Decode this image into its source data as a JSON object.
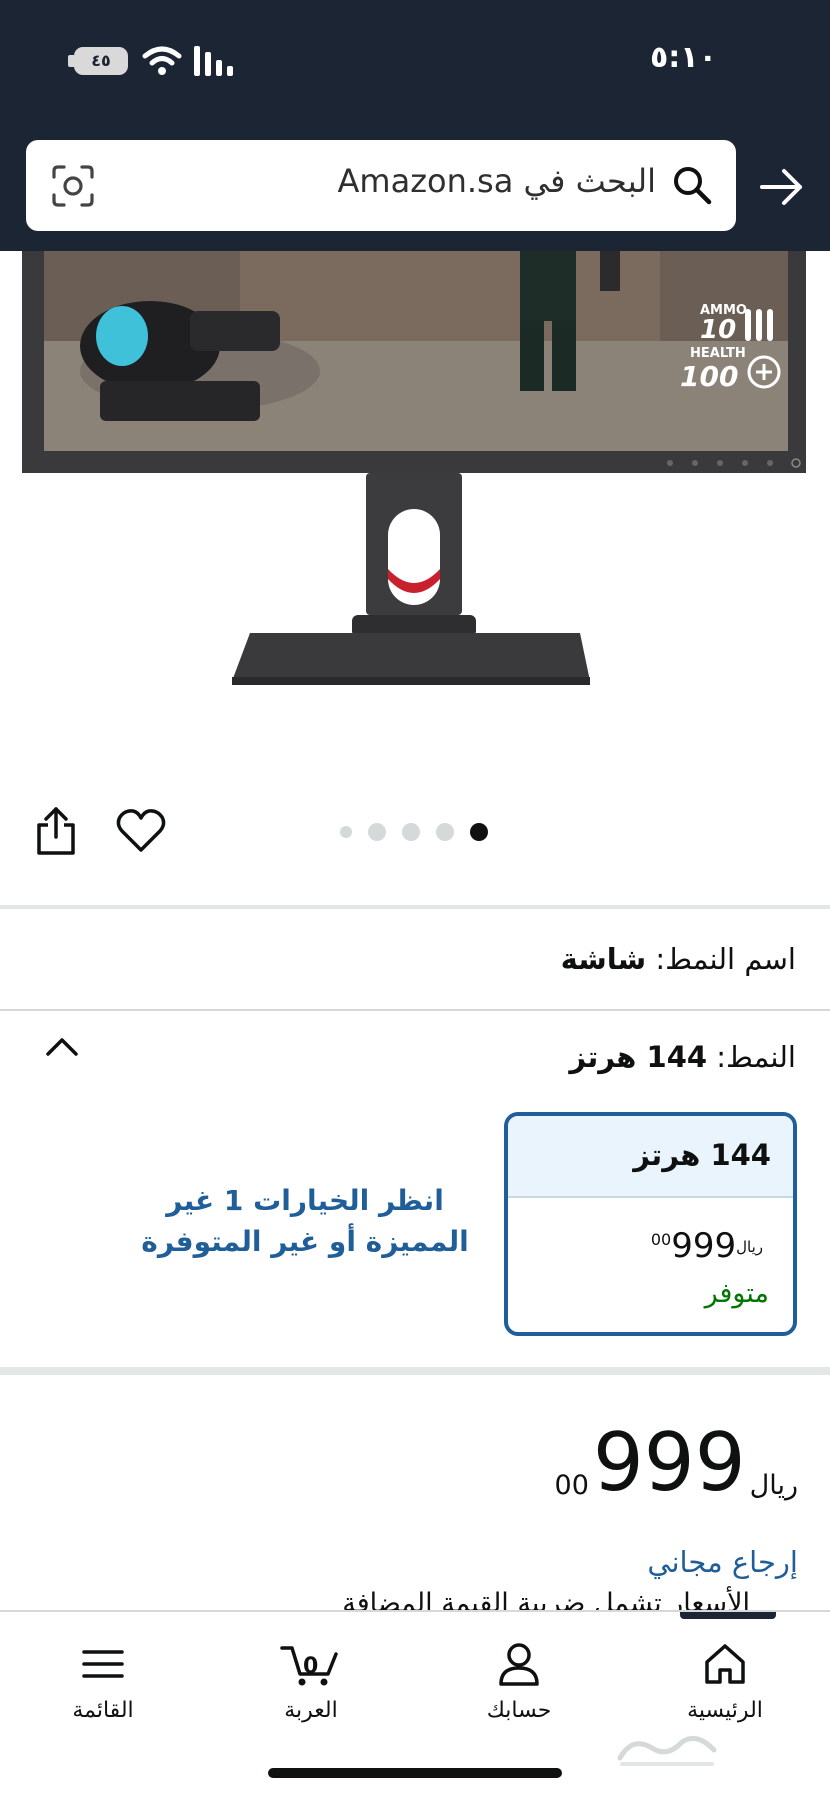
{
  "status_bar": {
    "time": "٥:١٠",
    "battery": "٤٥"
  },
  "search": {
    "placeholder": "البحث في Amazon.sa"
  },
  "carousel": {
    "total_images": 5,
    "active_index": 4
  },
  "product": {
    "style_name_label": "اسم النمط:",
    "style_name_value": "شاشة",
    "pattern_label": "النمط:",
    "pattern_value": "144 هرتز",
    "option": {
      "title": "144 هرتز",
      "price_whole": "999",
      "price_fraction": "00",
      "currency": "ريال",
      "availability": "متوفر"
    },
    "more_options_text": "انظر الخيارات 1 غير المميزة أو غير المتوفرة",
    "price": {
      "whole": "999",
      "fraction": "00",
      "currency": "ريال"
    },
    "free_return": "إرجاع مجاني",
    "price_note": "الأسعار تشمل ضريبة القيمة المضافة"
  },
  "bottom_nav": {
    "items": [
      {
        "label": "الرئيسية",
        "icon": "home-icon"
      },
      {
        "label": "حسابك",
        "icon": "account-icon"
      },
      {
        "label": "العربة",
        "icon": "cart-icon",
        "count": "0"
      },
      {
        "label": "القائمة",
        "icon": "menu-icon"
      }
    ],
    "active": "home"
  },
  "colors": {
    "header_bg": "#1b2533",
    "link_blue": "#1f5e98",
    "in_stock_green": "#007600",
    "card_head_bg": "#eaf4fc"
  }
}
